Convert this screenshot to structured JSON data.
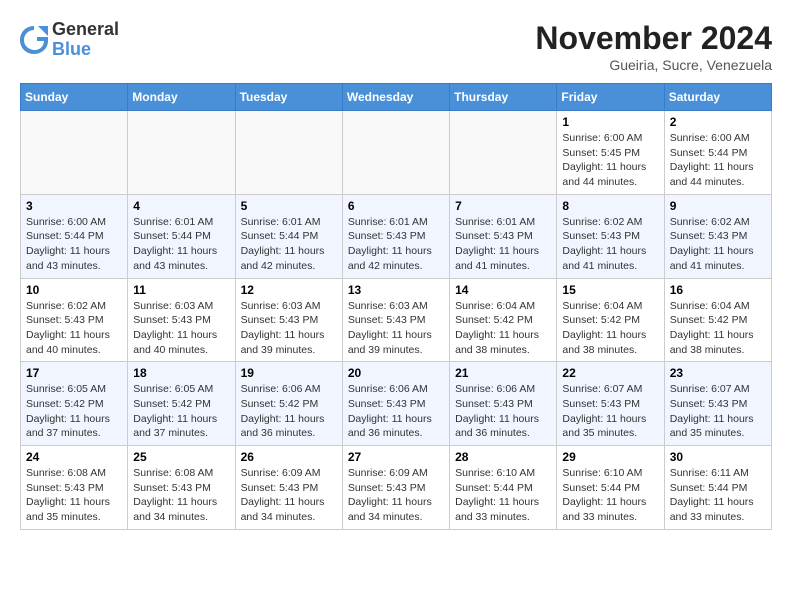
{
  "logo": {
    "general": "General",
    "blue": "Blue"
  },
  "title": "November 2024",
  "subtitle": "Gueiria, Sucre, Venezuela",
  "weekdays": [
    "Sunday",
    "Monday",
    "Tuesday",
    "Wednesday",
    "Thursday",
    "Friday",
    "Saturday"
  ],
  "weeks": [
    [
      {
        "day": "",
        "info": ""
      },
      {
        "day": "",
        "info": ""
      },
      {
        "day": "",
        "info": ""
      },
      {
        "day": "",
        "info": ""
      },
      {
        "day": "",
        "info": ""
      },
      {
        "day": "1",
        "info": "Sunrise: 6:00 AM\nSunset: 5:45 PM\nDaylight: 11 hours and 44 minutes."
      },
      {
        "day": "2",
        "info": "Sunrise: 6:00 AM\nSunset: 5:44 PM\nDaylight: 11 hours and 44 minutes."
      }
    ],
    [
      {
        "day": "3",
        "info": "Sunrise: 6:00 AM\nSunset: 5:44 PM\nDaylight: 11 hours and 43 minutes."
      },
      {
        "day": "4",
        "info": "Sunrise: 6:01 AM\nSunset: 5:44 PM\nDaylight: 11 hours and 43 minutes."
      },
      {
        "day": "5",
        "info": "Sunrise: 6:01 AM\nSunset: 5:44 PM\nDaylight: 11 hours and 42 minutes."
      },
      {
        "day": "6",
        "info": "Sunrise: 6:01 AM\nSunset: 5:43 PM\nDaylight: 11 hours and 42 minutes."
      },
      {
        "day": "7",
        "info": "Sunrise: 6:01 AM\nSunset: 5:43 PM\nDaylight: 11 hours and 41 minutes."
      },
      {
        "day": "8",
        "info": "Sunrise: 6:02 AM\nSunset: 5:43 PM\nDaylight: 11 hours and 41 minutes."
      },
      {
        "day": "9",
        "info": "Sunrise: 6:02 AM\nSunset: 5:43 PM\nDaylight: 11 hours and 41 minutes."
      }
    ],
    [
      {
        "day": "10",
        "info": "Sunrise: 6:02 AM\nSunset: 5:43 PM\nDaylight: 11 hours and 40 minutes."
      },
      {
        "day": "11",
        "info": "Sunrise: 6:03 AM\nSunset: 5:43 PM\nDaylight: 11 hours and 40 minutes."
      },
      {
        "day": "12",
        "info": "Sunrise: 6:03 AM\nSunset: 5:43 PM\nDaylight: 11 hours and 39 minutes."
      },
      {
        "day": "13",
        "info": "Sunrise: 6:03 AM\nSunset: 5:43 PM\nDaylight: 11 hours and 39 minutes."
      },
      {
        "day": "14",
        "info": "Sunrise: 6:04 AM\nSunset: 5:42 PM\nDaylight: 11 hours and 38 minutes."
      },
      {
        "day": "15",
        "info": "Sunrise: 6:04 AM\nSunset: 5:42 PM\nDaylight: 11 hours and 38 minutes."
      },
      {
        "day": "16",
        "info": "Sunrise: 6:04 AM\nSunset: 5:42 PM\nDaylight: 11 hours and 38 minutes."
      }
    ],
    [
      {
        "day": "17",
        "info": "Sunrise: 6:05 AM\nSunset: 5:42 PM\nDaylight: 11 hours and 37 minutes."
      },
      {
        "day": "18",
        "info": "Sunrise: 6:05 AM\nSunset: 5:42 PM\nDaylight: 11 hours and 37 minutes."
      },
      {
        "day": "19",
        "info": "Sunrise: 6:06 AM\nSunset: 5:42 PM\nDaylight: 11 hours and 36 minutes."
      },
      {
        "day": "20",
        "info": "Sunrise: 6:06 AM\nSunset: 5:43 PM\nDaylight: 11 hours and 36 minutes."
      },
      {
        "day": "21",
        "info": "Sunrise: 6:06 AM\nSunset: 5:43 PM\nDaylight: 11 hours and 36 minutes."
      },
      {
        "day": "22",
        "info": "Sunrise: 6:07 AM\nSunset: 5:43 PM\nDaylight: 11 hours and 35 minutes."
      },
      {
        "day": "23",
        "info": "Sunrise: 6:07 AM\nSunset: 5:43 PM\nDaylight: 11 hours and 35 minutes."
      }
    ],
    [
      {
        "day": "24",
        "info": "Sunrise: 6:08 AM\nSunset: 5:43 PM\nDaylight: 11 hours and 35 minutes."
      },
      {
        "day": "25",
        "info": "Sunrise: 6:08 AM\nSunset: 5:43 PM\nDaylight: 11 hours and 34 minutes."
      },
      {
        "day": "26",
        "info": "Sunrise: 6:09 AM\nSunset: 5:43 PM\nDaylight: 11 hours and 34 minutes."
      },
      {
        "day": "27",
        "info": "Sunrise: 6:09 AM\nSunset: 5:43 PM\nDaylight: 11 hours and 34 minutes."
      },
      {
        "day": "28",
        "info": "Sunrise: 6:10 AM\nSunset: 5:44 PM\nDaylight: 11 hours and 33 minutes."
      },
      {
        "day": "29",
        "info": "Sunrise: 6:10 AM\nSunset: 5:44 PM\nDaylight: 11 hours and 33 minutes."
      },
      {
        "day": "30",
        "info": "Sunrise: 6:11 AM\nSunset: 5:44 PM\nDaylight: 11 hours and 33 minutes."
      }
    ]
  ]
}
